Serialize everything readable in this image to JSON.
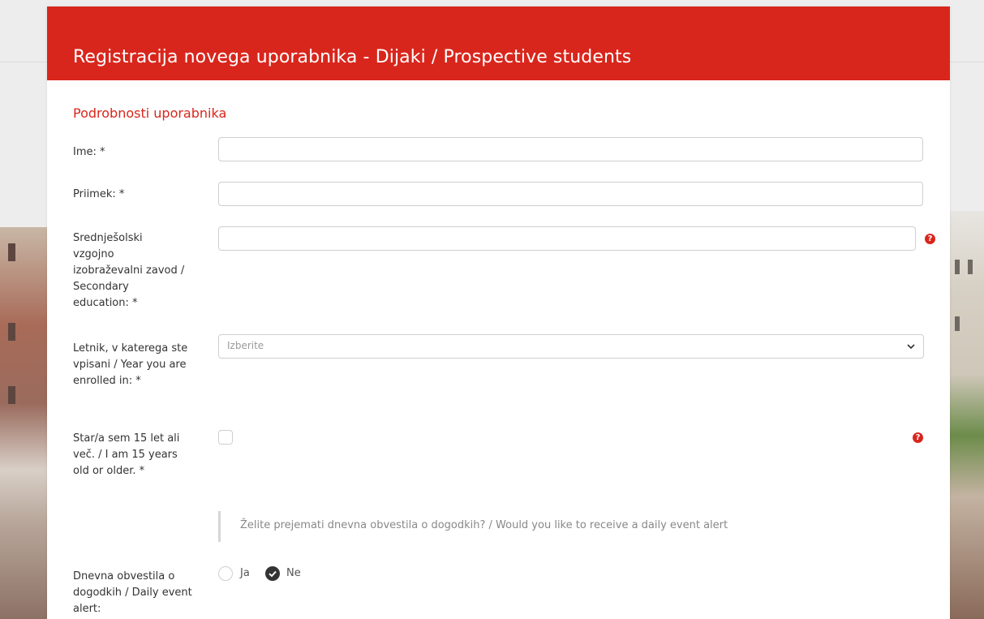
{
  "header": {
    "title": "Registracija novega uporabnika - Dijaki / Prospective students"
  },
  "section": {
    "title": "Podrobnosti uporabnika"
  },
  "fields": {
    "first_name_label": "Ime: *",
    "last_name_label": "Priimek: *",
    "school_label": "Srednješolski vzgojno izobraževalni zavod / Secondary education: *",
    "year_label": "Letnik, v katerega ste vpisani / Year you are enrolled in: *",
    "year_placeholder": "Izberite",
    "age_label": "Star/a sem 15 let ali več. / I am 15 years old or older. *",
    "daily_notice": "Želite prejemati dnevna obvestila o dogodkih? / Would you like to receive a daily event alert",
    "daily_label": "Dnevna obvestila o dogodkih / Daily event alert:",
    "radio_yes": "Ja",
    "radio_no": "Ne",
    "help_symbol": "?"
  },
  "colors": {
    "brand_red": "#d9261c"
  },
  "icons": {
    "help": "question-circle-icon",
    "select": "chevron-down-icon",
    "radio_checked": "check-circle-icon"
  }
}
